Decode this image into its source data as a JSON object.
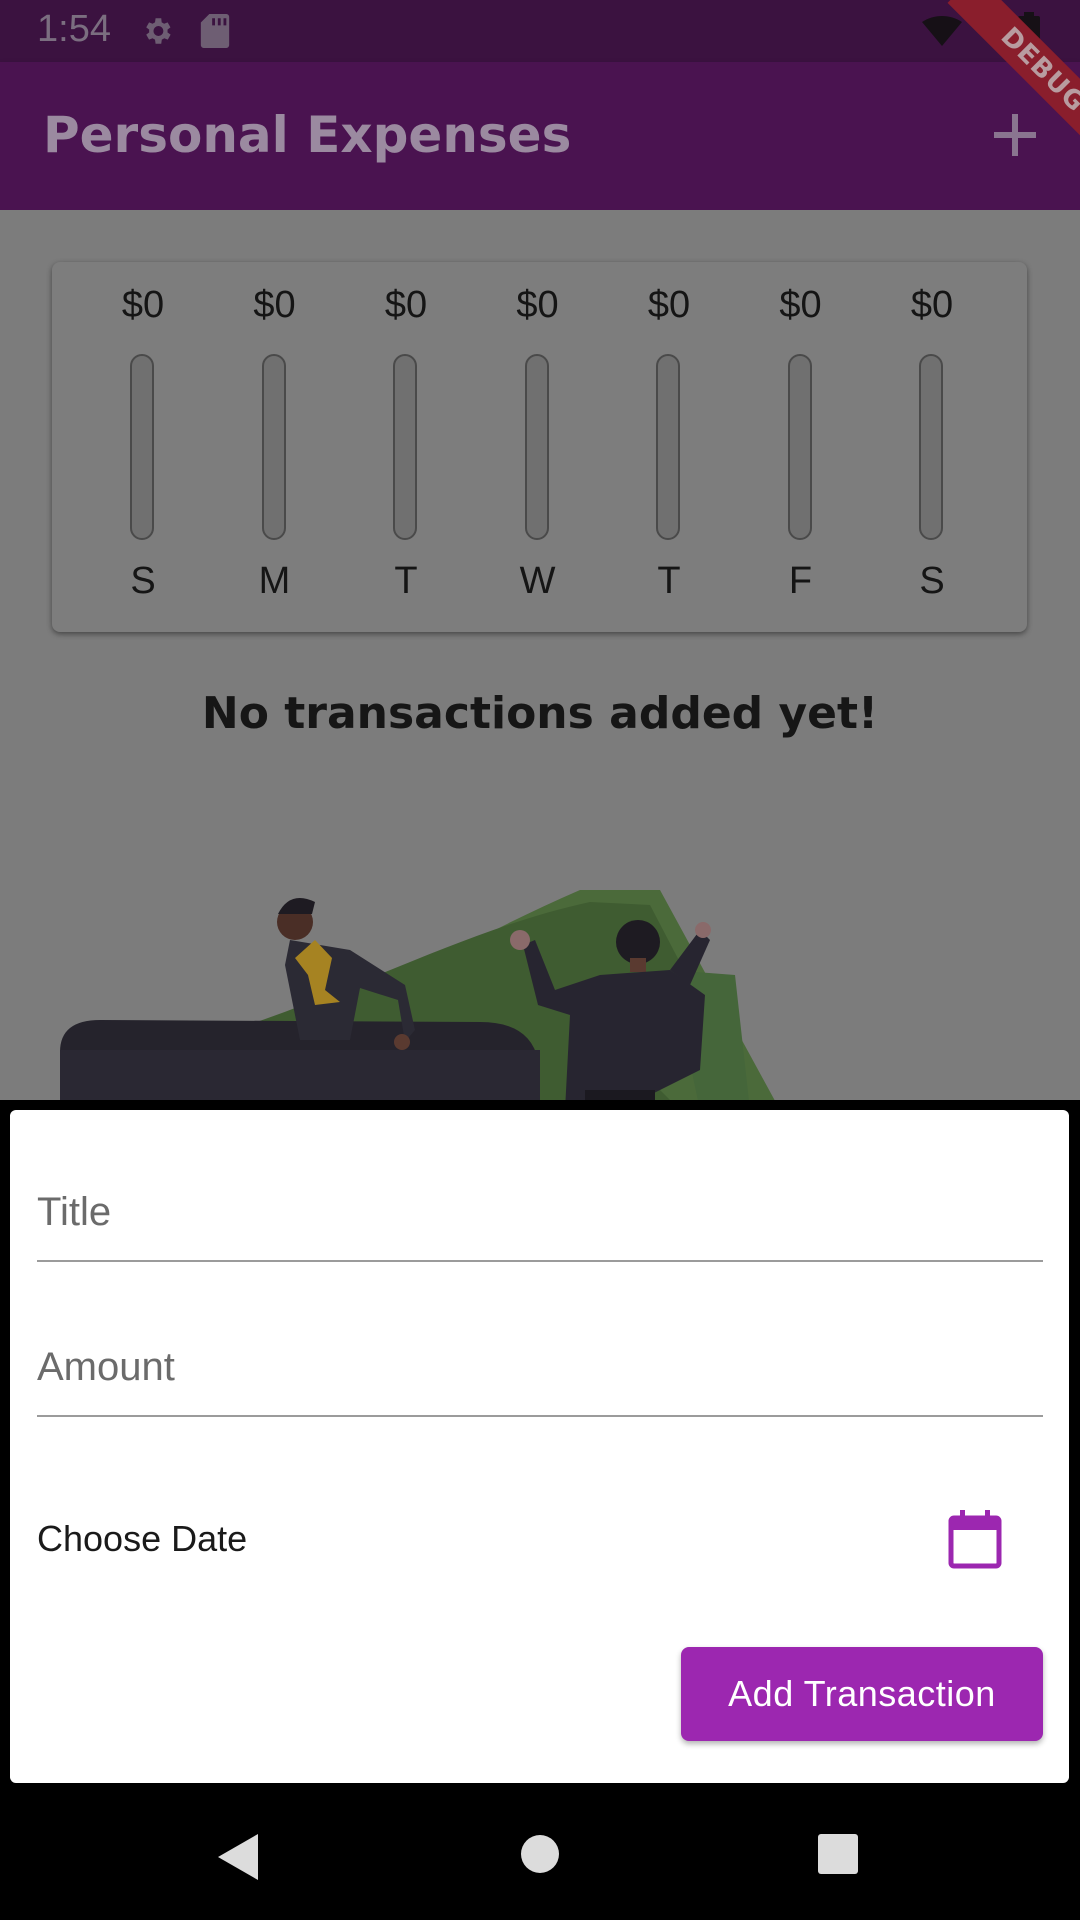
{
  "status_bar": {
    "time": "1:54",
    "icons": [
      "settings-icon",
      "sd-card-icon",
      "wifi-icon",
      "battery-icon"
    ]
  },
  "debug_banner": {
    "label": "DEBUG"
  },
  "app_bar": {
    "title": "Personal Expenses",
    "action_icon": "add-icon",
    "color": "#4a1350"
  },
  "chart": {
    "days": [
      {
        "amount": "$0",
        "label": "S",
        "fraction": 0
      },
      {
        "amount": "$0",
        "label": "M",
        "fraction": 0
      },
      {
        "amount": "$0",
        "label": "T",
        "fraction": 0
      },
      {
        "amount": "$0",
        "label": "W",
        "fraction": 0
      },
      {
        "amount": "$0",
        "label": "T",
        "fraction": 0
      },
      {
        "amount": "$0",
        "label": "F",
        "fraction": 0
      },
      {
        "amount": "$0",
        "label": "S",
        "fraction": 0
      }
    ]
  },
  "empty_state": {
    "message": "No transactions added yet!",
    "image": "money-illustration"
  },
  "form": {
    "title_placeholder": "Title",
    "amount_placeholder": "Amount",
    "date_label": "Choose Date",
    "date_icon": "calendar-icon",
    "submit_label": "Add Transaction",
    "accent": "#9c27b0"
  },
  "nav_bar": {
    "icons": [
      "back-icon",
      "home-icon",
      "recents-icon"
    ]
  }
}
